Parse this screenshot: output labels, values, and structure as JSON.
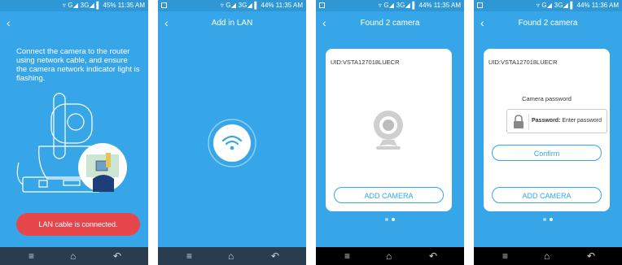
{
  "screens": [
    {
      "status_time": "11:35 AM",
      "battery": "45%",
      "title": "",
      "instruction": "Connect the camera to the router using network cable, and ensure the camera network indicator light is flashing.",
      "status_button": "LAN cable is connected."
    },
    {
      "status_time": "11:35 AM",
      "battery": "44%",
      "title": "Add in LAN"
    },
    {
      "status_time": "11:35 AM",
      "battery": "44%",
      "title": "Found 2 camera",
      "uid": "UID:VSTA127018LUECR",
      "add_button": "ADD CAMERA"
    },
    {
      "status_time": "11:36 AM",
      "battery": "44%",
      "title": "Found 2 camera",
      "uid": "UID:VSTA127018LUECR",
      "password_label": "Camera password",
      "password_field_label": "Password:",
      "password_placeholder": "Enter password",
      "confirm_button": "Confirm",
      "add_button": "ADD CAMERA"
    }
  ],
  "status_icons": "▿ G◢ 3G◢ ▌",
  "nav": {
    "menu": "≡",
    "home": "⌂",
    "back": "↶"
  },
  "back_arrow": "‹",
  "colors": {
    "primary": "#37a6e8",
    "status": "#2f97d6",
    "alert": "#e7464b",
    "navbar": "#2a3d4f"
  }
}
